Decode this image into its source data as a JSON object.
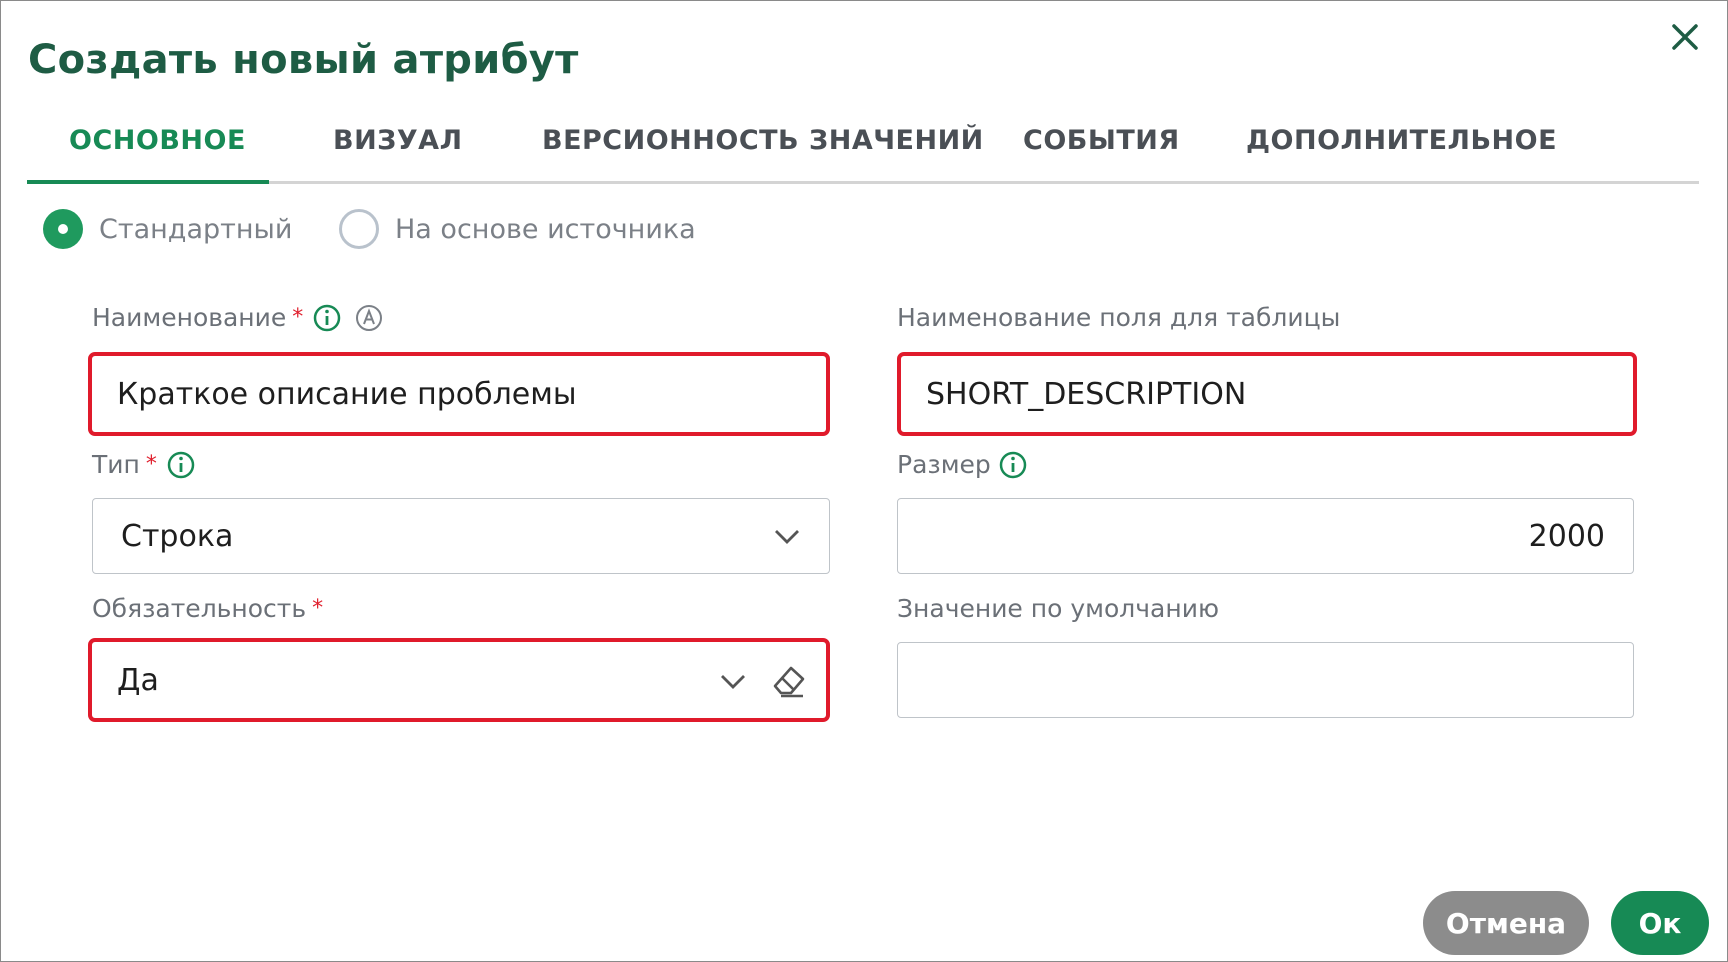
{
  "dialog": {
    "title": "Создать новый атрибут",
    "close_icon": "close-icon"
  },
  "tabs": [
    {
      "label": "ОСНОВНОЕ",
      "active": true
    },
    {
      "label": "ВИЗУАЛ",
      "active": false
    },
    {
      "label": "ВЕРСИОННОСТЬ ЗНАЧЕНИЙ",
      "active": false
    },
    {
      "label": "СОБЫТИЯ",
      "active": false
    },
    {
      "label": "ДОПОЛНИТЕЛЬНОЕ",
      "active": false
    }
  ],
  "mode": {
    "options": [
      {
        "label": "Стандартный",
        "checked": true
      },
      {
        "label": "На основе источника",
        "checked": false
      }
    ]
  },
  "fields": {
    "name": {
      "label": "Наименование",
      "required": "*",
      "value": "Краткое описание проблемы"
    },
    "table_field": {
      "label": "Наименование поля для таблицы",
      "value": "SHORT_DESCRIPTION"
    },
    "type": {
      "label": "Тип",
      "required": "*",
      "value": "Строка"
    },
    "size": {
      "label": "Размер",
      "value": "2000"
    },
    "required_flag": {
      "label": "Обязательность",
      "required": "*",
      "value": "Да"
    },
    "default_value": {
      "label": "Значение по умолчанию",
      "value": ""
    }
  },
  "buttons": {
    "cancel": "Отмена",
    "ok": "Ок"
  },
  "colors": {
    "accent": "#178a55",
    "title": "#1e5c44",
    "highlight": "#e01a2b",
    "required": "#e0202e",
    "cancel_bg": "#8c8c8c"
  }
}
